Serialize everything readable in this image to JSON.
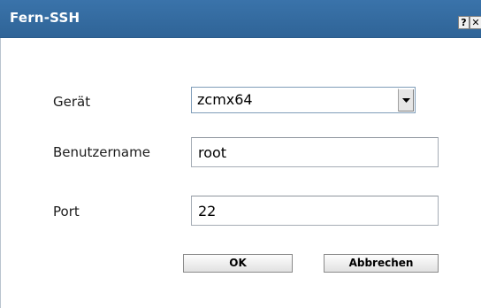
{
  "window": {
    "title": "Fern-SSH",
    "help_label": "?",
    "close_label": "✕"
  },
  "form": {
    "device": {
      "label": "Gerät",
      "value": "zcmx64"
    },
    "username": {
      "label": "Benutzername",
      "value": "root"
    },
    "port": {
      "label": "Port",
      "value": "22"
    }
  },
  "buttons": {
    "ok_label": "OK",
    "cancel_label": "Abbrechen"
  }
}
